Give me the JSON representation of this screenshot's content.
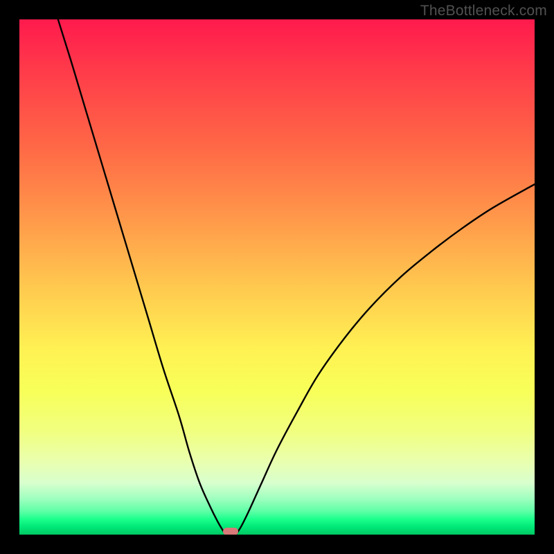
{
  "watermark": "TheBottleneck.com",
  "chart_data": {
    "type": "line",
    "title": "",
    "xlabel": "",
    "ylabel": "",
    "xlim": [
      0,
      100
    ],
    "ylim": [
      0,
      100
    ],
    "grid": false,
    "series": [
      {
        "name": "left-curve",
        "x": [
          7.5,
          10,
          13,
          16,
          19,
          22,
          25,
          28,
          31,
          33,
          35,
          37,
          38.5,
          39.5,
          40
        ],
        "y": [
          100,
          92,
          82,
          72,
          62,
          52,
          42,
          32,
          23,
          16,
          10,
          5.5,
          2.5,
          0.8,
          0
        ]
      },
      {
        "name": "right-curve",
        "x": [
          42,
          43,
          44.5,
          47,
          50,
          54,
          58,
          63,
          68,
          74,
          80,
          86,
          92,
          100
        ],
        "y": [
          0,
          1.5,
          4.5,
          10,
          16.5,
          24,
          31,
          38,
          44,
          50,
          55,
          59.5,
          63.5,
          68
        ]
      }
    ],
    "marker": {
      "name": "bottleneck-marker",
      "x_center": 41,
      "width_pct": 3,
      "color": "#d87a7a"
    },
    "background_gradient_stops": [
      {
        "pct": 0,
        "color": "#ff1a4d"
      },
      {
        "pct": 25,
        "color": "#ff6946"
      },
      {
        "pct": 52,
        "color": "#ffc94f"
      },
      {
        "pct": 72,
        "color": "#f8ff58"
      },
      {
        "pct": 90,
        "color": "#d7ffce"
      },
      {
        "pct": 100,
        "color": "#00c864"
      }
    ]
  }
}
